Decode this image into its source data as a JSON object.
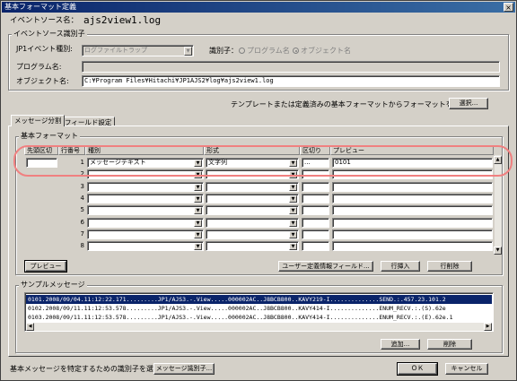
{
  "window": {
    "title": "基本フォーマット定義",
    "close": "×"
  },
  "event_source": {
    "label": "イベントソース名：",
    "value": "ajs2view1.log"
  },
  "event_id_group": {
    "title": "イベントソース識別子",
    "jp1_type_label": "JP1イベント種別:",
    "jp1_type_value": "ログファイルトラップ",
    "identifier_label": "識別子：",
    "radio_program": "プログラム名",
    "radio_object": "オブジェクト名",
    "program_label": "プログラム名:",
    "program_value": "",
    "object_label": "オブジェクト名:",
    "object_value": "C:¥Program Files¥Hitachi¥JP1AJS2¥log¥ajs2view1.log"
  },
  "template_prompt": "テンプレートまたは定義済みの基本フォーマットからフォーマットを選択",
  "select_button": "選択...",
  "tabs": [
    {
      "label": "メッセージ分割"
    },
    {
      "label": "フィールド設定"
    }
  ],
  "basic_format": {
    "title": "基本フォーマット",
    "headers": {
      "delim": "先頭区切",
      "row": "行番号",
      "type": "種別",
      "form": "形式",
      "end_delim": "区切り",
      "preview": "プレビュー"
    },
    "rows": [
      {
        "num": "1",
        "type": "メッセージテキスト",
        "form": "文字列",
        "end_delim": "...",
        "preview": "0101"
      },
      {
        "num": "2",
        "type": "",
        "form": "",
        "end_delim": "",
        "preview": ""
      },
      {
        "num": "3",
        "type": "",
        "form": "",
        "end_delim": "",
        "preview": ""
      },
      {
        "num": "4",
        "type": "",
        "form": "",
        "end_delim": "",
        "preview": ""
      },
      {
        "num": "5",
        "type": "",
        "form": "",
        "end_delim": "",
        "preview": ""
      },
      {
        "num": "6",
        "type": "",
        "form": "",
        "end_delim": "",
        "preview": ""
      },
      {
        "num": "7",
        "type": "",
        "form": "",
        "end_delim": "",
        "preview": ""
      },
      {
        "num": "8",
        "type": "",
        "form": "",
        "end_delim": "",
        "preview": ""
      }
    ],
    "preview_button": "プレビュー",
    "user_def_button": "ユーザー定義情報フィールド...",
    "insert_button": "行挿入",
    "delete_row_button": "行削除"
  },
  "sample_messages": {
    "title": "サンプルメッセージ",
    "rows": [
      "0101.2008/09/04.11:12:22.171.........JP1/AJS3.-.View.....000002AC..J8BCB800..KAVY219-I..............SEND.:.457.23.101.2",
      "0102.2008/09/11.11:12:53.578.........JP1/AJS3.-.View.....000002AC..J8BCB800..KAVY414-I..............ENUM_RECV.:.(S).62e",
      "0103.2008/09/11.11:12:53.578.........JP1/AJS3.-.View.....000002AC..J8BCB800..KAVY414-I..............ENUM_RECV.:.(E).62e.1"
    ],
    "add_button": "追加...",
    "delete_button": "削除"
  },
  "footer": {
    "prompt": "基本メッセージを特定するための識別子を選択",
    "msg_id_button": "メッセージ識別子...",
    "ok_button": "ＯＫ",
    "cancel_button": "キャンセル"
  },
  "colors": {
    "selection": "#0a246a",
    "callout": "#f08080",
    "face": "#d4d0c8"
  }
}
